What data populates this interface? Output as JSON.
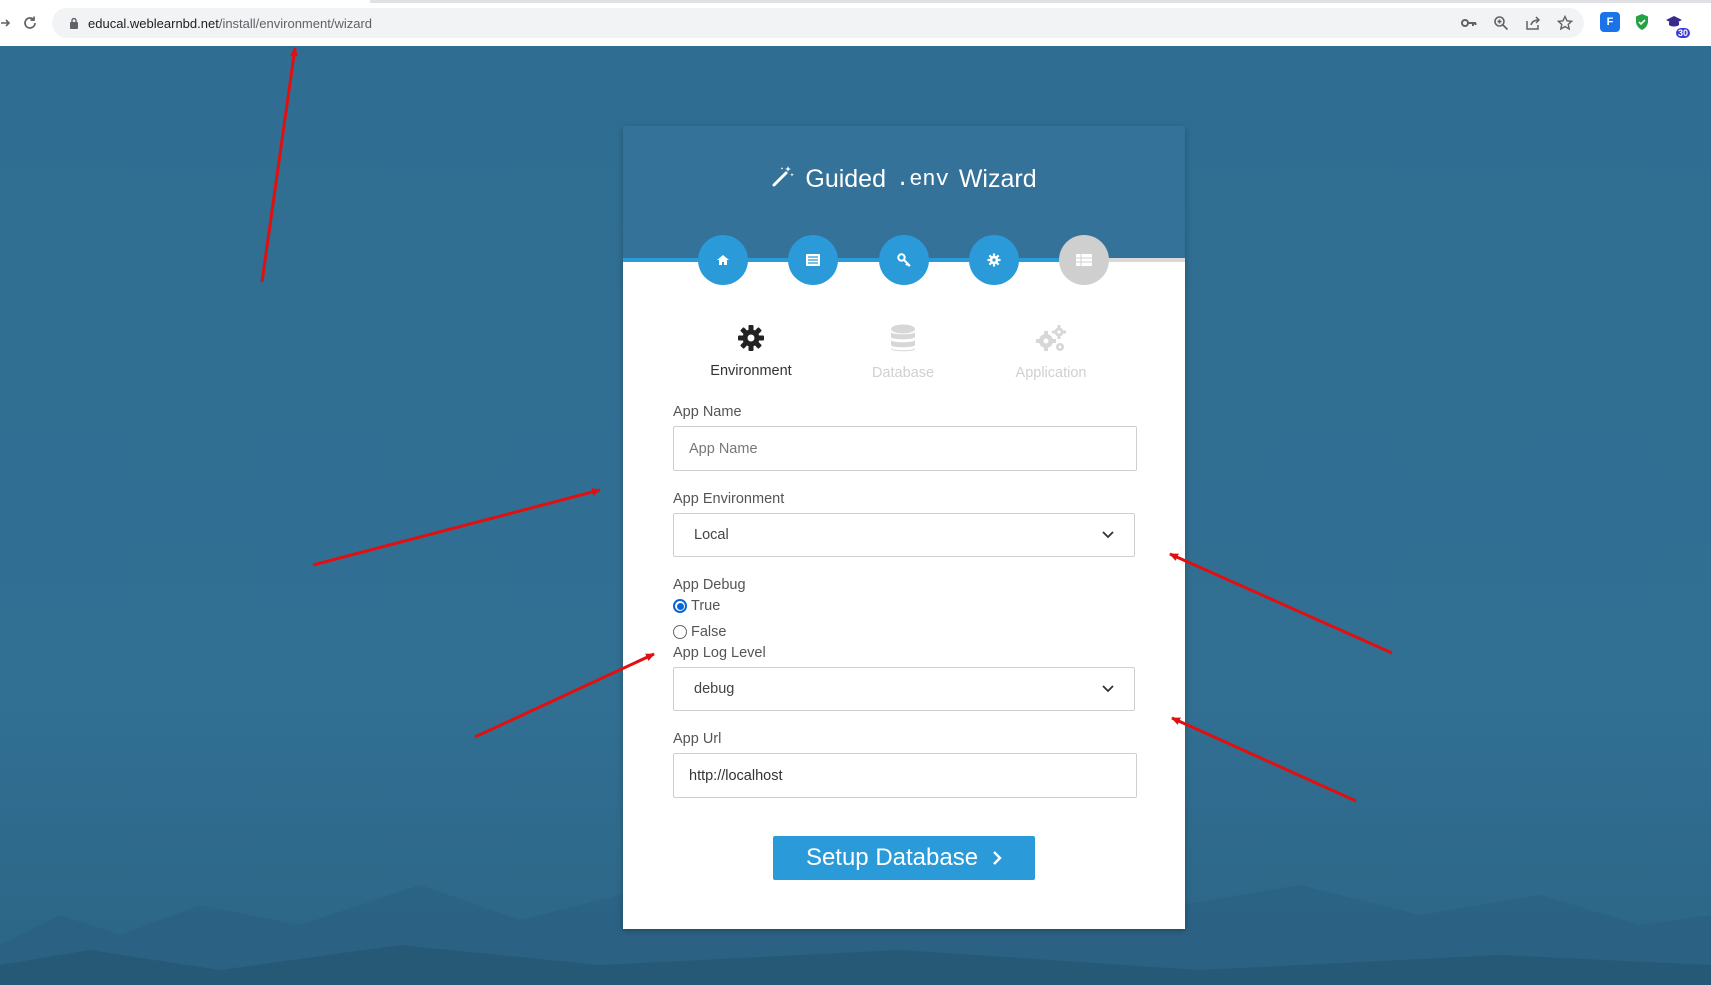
{
  "browser": {
    "url_host": "educal.weblearnbd.net",
    "url_path": "/install/environment/wizard",
    "extension_badge": "30"
  },
  "wizard": {
    "title_guided": "Guided",
    "title_env": ".env",
    "title_wizard": "Wizard",
    "steps": [
      {
        "icon": "home-icon",
        "state": "complete"
      },
      {
        "icon": "list-icon",
        "state": "complete"
      },
      {
        "icon": "key-icon",
        "state": "complete"
      },
      {
        "icon": "gear-icon",
        "state": "complete"
      },
      {
        "icon": "server-icon",
        "state": "inactive"
      }
    ],
    "tabs": [
      {
        "label": "Environment",
        "icon": "gear-icon",
        "state": "active"
      },
      {
        "label": "Database",
        "icon": "database-icon",
        "state": "disabled"
      },
      {
        "label": "Application",
        "icon": "gears-icon",
        "state": "disabled"
      }
    ]
  },
  "form": {
    "app_name": {
      "label": "App Name",
      "placeholder": "App Name",
      "value": ""
    },
    "app_environment": {
      "label": "App Environment",
      "selected": "Local"
    },
    "app_debug": {
      "label": "App Debug",
      "options": [
        "True",
        "False"
      ],
      "selected": "True"
    },
    "app_log_level": {
      "label": "App Log Level",
      "selected": "debug"
    },
    "app_url": {
      "label": "App Url",
      "value": "http://localhost"
    },
    "submit_label": "Setup Database"
  },
  "colors": {
    "accent": "#2a9ad8",
    "header": "#347299",
    "background": "#2f6f93",
    "annotation": "#e01010"
  }
}
